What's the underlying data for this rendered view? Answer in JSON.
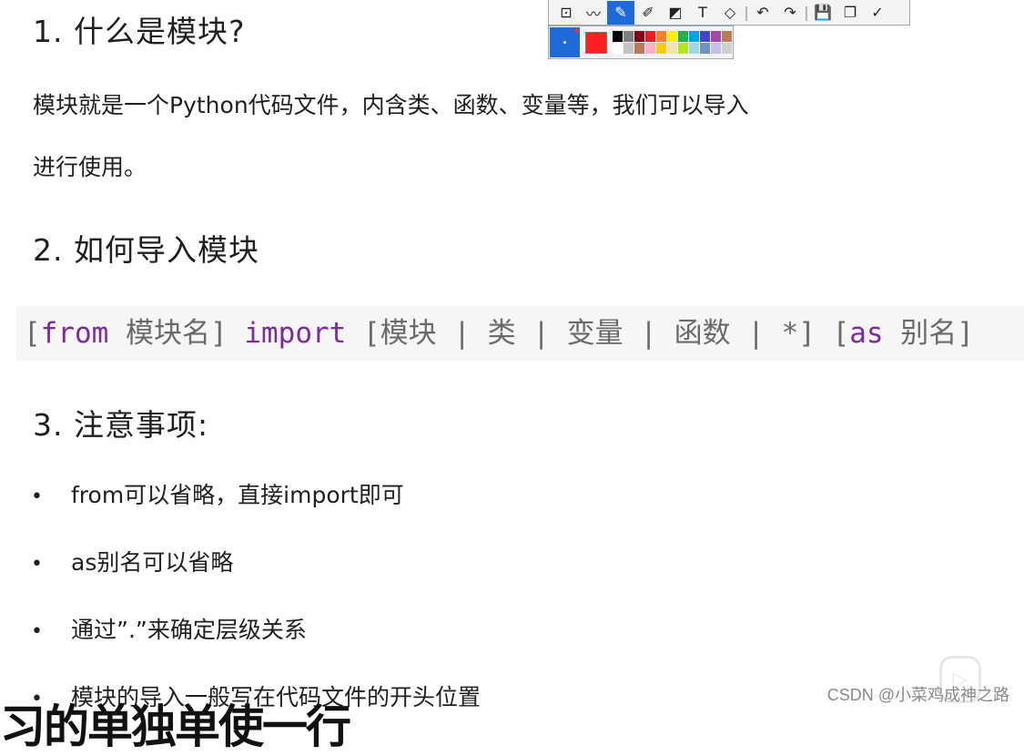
{
  "heading1": "1. 什么是模块?",
  "para1_line1": "模块就是一个Python代码文件，内含类、函数、变量等，我们可以导入",
  "para1_line2": "进行使用。",
  "heading2": "2. 如何导入模块",
  "code": {
    "p1": "[",
    "kw_from": "from",
    "t1": " 模块名] ",
    "kw_import": "import",
    "t2": " [模块 | 类 | 变量 | 函数 | *] [",
    "kw_as": "as",
    "t3": " 别名]"
  },
  "heading3": "3. 注意事项:",
  "bullets": [
    "from可以省略，直接import即可",
    "as别名可以省略",
    "通过”.”来确定层级关系",
    "模块的导入一般写在代码文件的开头位置"
  ],
  "bullet_symbol": "•",
  "toolbar": {
    "icons": [
      "rect-select-icon",
      "curve-icon",
      "pencil-icon",
      "marker-icon",
      "mosaic-icon",
      "text-icon",
      "eraser-icon",
      "undo-icon",
      "redo-icon",
      "save-icon",
      "copy-icon",
      "confirm-icon"
    ],
    "glyphs": [
      "⊡",
      "〰",
      "✎",
      "✐",
      "◩",
      "T",
      "◇",
      "↶",
      "↷",
      "💾",
      "❐",
      "✓"
    ]
  },
  "palette_colors": [
    "#000000",
    "#7f7f7f",
    "#880015",
    "#ed1c24",
    "#ff7f27",
    "#fff200",
    "#22b14c",
    "#00a2e8",
    "#3f48cc",
    "#a349a4",
    "#b97a57",
    "#ffffff",
    "#c3c3c3",
    "#b97a57",
    "#ffaec9",
    "#ffc90e",
    "#efe4b0",
    "#b5e61d",
    "#99d9ea",
    "#7092be",
    "#c8bfe7",
    "#d0d0d0"
  ],
  "watermark": "CSDN @小菜鸡成神之路",
  "overlay_subtitle": "习的单独单使一行"
}
